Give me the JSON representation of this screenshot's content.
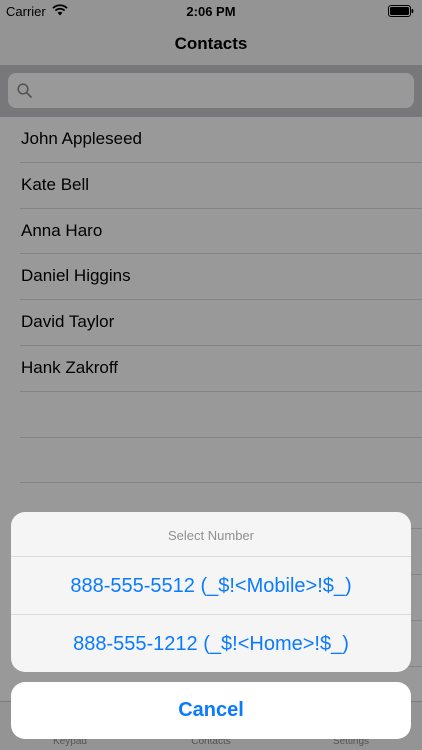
{
  "status_bar": {
    "carrier": "Carrier",
    "time": "2:06 PM"
  },
  "nav": {
    "title": "Contacts"
  },
  "search": {
    "placeholder": ""
  },
  "contacts": [
    {
      "name": "John Appleseed"
    },
    {
      "name": "Kate Bell"
    },
    {
      "name": "Anna Haro"
    },
    {
      "name": "Daniel Higgins"
    },
    {
      "name": "David Taylor"
    },
    {
      "name": "Hank Zakroff"
    }
  ],
  "tab_bar": {
    "items": [
      {
        "label": "Keypad"
      },
      {
        "label": "Contacts"
      },
      {
        "label": "Settings"
      }
    ]
  },
  "action_sheet": {
    "title": "Select Number",
    "options": [
      {
        "label": "888-555-5512 (_$!<Mobile>!$_)"
      },
      {
        "label": "888-555-1212 (_$!<Home>!$_)"
      }
    ],
    "cancel_label": "Cancel"
  },
  "colors": {
    "accent": "#0a7aff",
    "overlay": "#00000066"
  },
  "icons": {
    "wifi": "wifi-icon",
    "battery": "battery-icon",
    "search": "search-icon"
  }
}
